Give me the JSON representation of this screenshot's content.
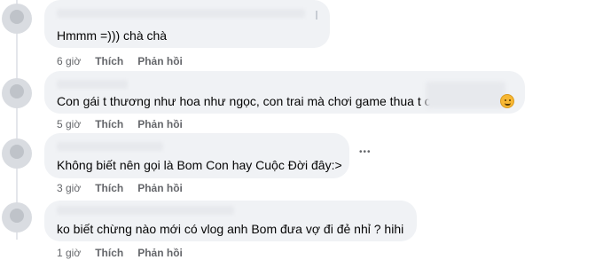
{
  "comments": [
    {
      "text": "Hmmm =))) chà chà",
      "time": "6 giờ",
      "like_label": "Thích",
      "reply_label": "Phản hồi"
    },
    {
      "text": "Con gái t thương như hoa như ngọc, con trai mà chơi game thua t c",
      "time": "5 giờ",
      "like_label": "Thích",
      "reply_label": "Phản hồi",
      "emoji_icon": "smiling-face-icon"
    },
    {
      "text": "Không biết nên gọi là Bom Con hay Cuộc Đời đây:>",
      "time": "3 giờ",
      "like_label": "Thích",
      "reply_label": "Phản hồi",
      "more_label": "•••"
    },
    {
      "text": "ko biết chừng nào mới có vlog anh Bom đưa vợ đi đẻ nhỉ ? hihi",
      "time": "1 giờ",
      "like_label": "Thích",
      "reply_label": "Phản hồi"
    }
  ]
}
